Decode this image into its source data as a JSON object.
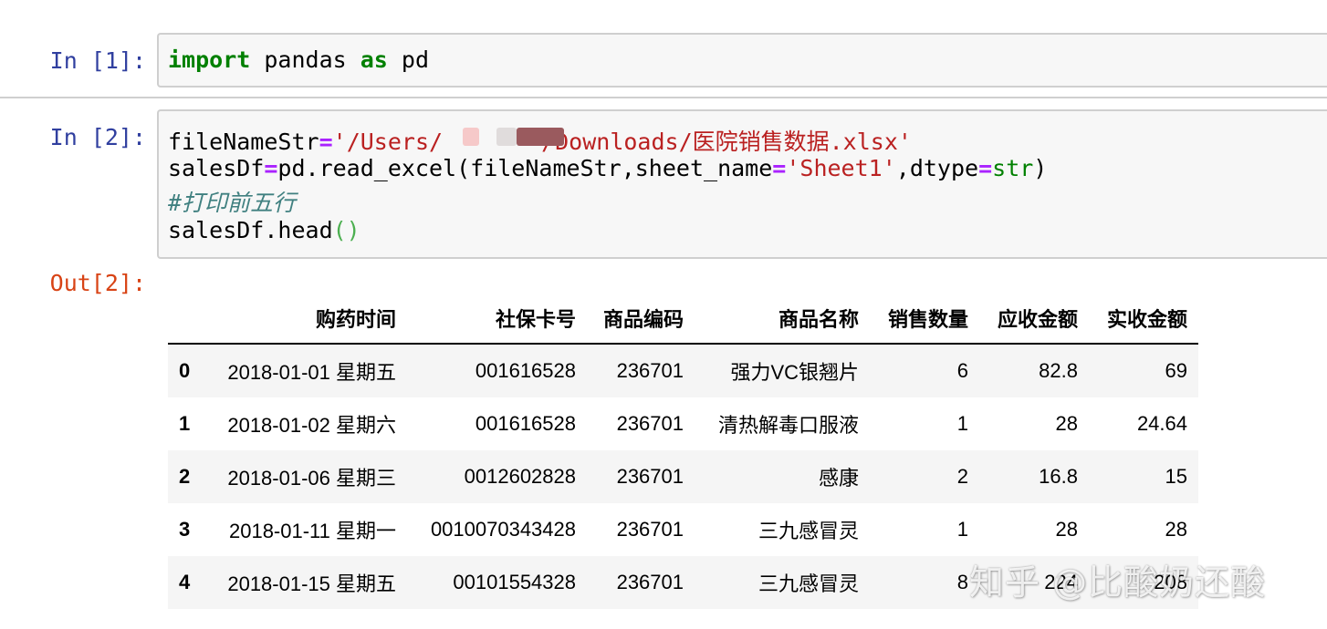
{
  "cells": [
    {
      "prompt": "In [1]:",
      "code": {
        "kw1": "import",
        "t1": " pandas ",
        "kw2": "as",
        "t2": " pd"
      }
    },
    {
      "prompt": "In [2]:",
      "code": {
        "l1_var": "fileNameStr",
        "l1_eq": "=",
        "l1_str_a": "'/Users/",
        "l1_str_b": "/Downloads/医院销售数据.xlsx'",
        "l2_a": "salesDf",
        "l2_eq": "=",
        "l2_b": "pd.read_excel(fileNameStr,sheet_name",
        "l2_eq2": "=",
        "l2_str": "'Sheet1'",
        "l2_c": ",dtype",
        "l2_eq3": "=",
        "l2_kw": "str",
        "l2_d": ")",
        "l3_comment": "#打印前五行",
        "l4_a": "salesDf.head",
        "l4_paren": "()"
      },
      "out_prompt": "Out[2]:"
    }
  ],
  "dataframe": {
    "columns": [
      "",
      "购药时间",
      "社保卡号",
      "商品编码",
      "商品名称",
      "销售数量",
      "应收金额",
      "实收金额"
    ],
    "rows": [
      [
        "0",
        "2018-01-01 星期五",
        "001616528",
        "236701",
        "强力VC银翘片",
        "6",
        "82.8",
        "69"
      ],
      [
        "1",
        "2018-01-02 星期六",
        "001616528",
        "236701",
        "清热解毒口服液",
        "1",
        "28",
        "24.64"
      ],
      [
        "2",
        "2018-01-06 星期三",
        "0012602828",
        "236701",
        "感康",
        "2",
        "16.8",
        "15"
      ],
      [
        "3",
        "2018-01-11 星期一",
        "0010070343428",
        "236701",
        "三九感冒灵",
        "1",
        "28",
        "28"
      ],
      [
        "4",
        "2018-01-15 星期五",
        "00101554328",
        "236701",
        "三九感冒灵",
        "8",
        "224",
        "208"
      ]
    ]
  },
  "watermark": "知乎 @比酸奶还酸",
  "colors": {
    "prompt_in": "#303f9f",
    "prompt_out": "#d84315",
    "keyword": "#008000",
    "string": "#ba2121",
    "operator": "#aa22ff",
    "comment": "#408080"
  }
}
